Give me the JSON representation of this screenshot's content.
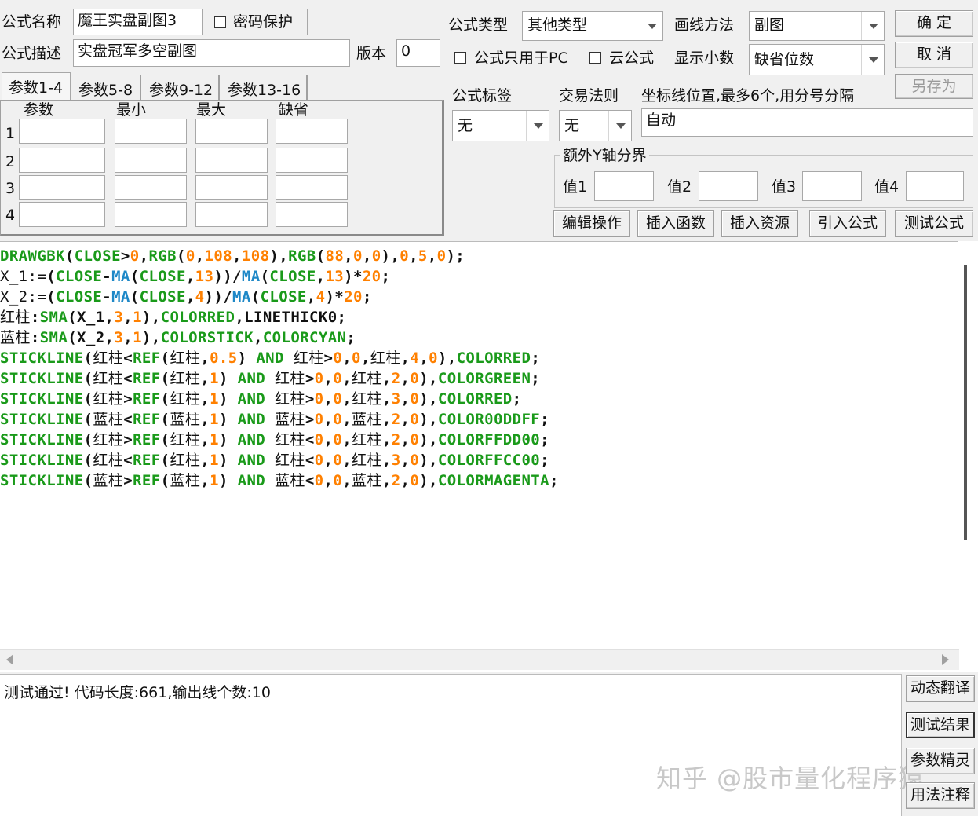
{
  "formula": {
    "name_label": "公式名称",
    "name_value": "魔王实盘副图3",
    "password_label": "密码保护",
    "desc_label": "公式描述",
    "desc_value": "实盘冠军多空副图",
    "version_label": "版本",
    "version_value": "0",
    "type_label": "公式类型",
    "type_value": "其他类型",
    "draw_label": "画线方法",
    "draw_value": "副图",
    "pc_only_label": "公式只用于PC",
    "cloud_label": "云公式",
    "decimals_label": "显示小数",
    "decimals_value": "缺省位数",
    "tag_label": "公式标签",
    "tag_value": "无",
    "trade_label": "交易法则",
    "trade_value": "无",
    "coord_label": "坐标线位置,最多6个,用分号分隔",
    "coord_value": "自动",
    "extra_y_label": "额外Y轴分界",
    "extra_y": [
      "值1",
      "值2",
      "值3",
      "值4"
    ]
  },
  "buttons": {
    "ok": "确  定",
    "cancel": "取  消",
    "save_as": "另存为",
    "edit_ops": "编辑操作",
    "insert_func": "插入函数",
    "insert_res": "插入资源",
    "import_formula": "引入公式",
    "test_formula": "测试公式",
    "dyn_translate": "动态翻译",
    "test_result": "测试结果",
    "param_wizard": "参数精灵",
    "usage_notes": "用法注释"
  },
  "tabs": [
    "参数1-4",
    "参数5-8",
    "参数9-12",
    "参数13-16"
  ],
  "params": {
    "headers": [
      "参数",
      "最小",
      "最大",
      "缺省"
    ],
    "rows": [
      "1",
      "2",
      "3",
      "4"
    ]
  },
  "code_lines": [
    [
      [
        "fn",
        "DRAWGBK"
      ],
      [
        "op",
        "("
      ],
      [
        "fn",
        "CLOSE"
      ],
      [
        "op",
        ">"
      ],
      [
        "num",
        "0"
      ],
      [
        "op",
        ","
      ],
      [
        "fn",
        "RGB"
      ],
      [
        "op",
        "("
      ],
      [
        "num",
        "0"
      ],
      [
        "op",
        ","
      ],
      [
        "num",
        "108"
      ],
      [
        "op",
        ","
      ],
      [
        "num",
        "108"
      ],
      [
        "op",
        "),"
      ],
      [
        "fn",
        "RGB"
      ],
      [
        "op",
        "("
      ],
      [
        "num",
        "88"
      ],
      [
        "op",
        ","
      ],
      [
        "num",
        "0"
      ],
      [
        "op",
        ","
      ],
      [
        "num",
        "0"
      ],
      [
        "op",
        "),"
      ],
      [
        "num",
        "0"
      ],
      [
        "op",
        ","
      ],
      [
        "num",
        "5"
      ],
      [
        "op",
        ","
      ],
      [
        "num",
        "0"
      ],
      [
        "op",
        ");"
      ]
    ],
    [
      [
        "var",
        "X_1:="
      ],
      [
        "op",
        "("
      ],
      [
        "fn",
        "CLOSE"
      ],
      [
        "op",
        "-"
      ],
      [
        "blue",
        "MA"
      ],
      [
        "op",
        "("
      ],
      [
        "fn",
        "CLOSE"
      ],
      [
        "op",
        ","
      ],
      [
        "num",
        "13"
      ],
      [
        "op",
        "))/"
      ],
      [
        "blue",
        "MA"
      ],
      [
        "op",
        "("
      ],
      [
        "fn",
        "CLOSE"
      ],
      [
        "op",
        ","
      ],
      [
        "num",
        "13"
      ],
      [
        "op",
        ")*"
      ],
      [
        "num",
        "20"
      ],
      [
        "op",
        ";"
      ]
    ],
    [
      [
        "var",
        "X_2:="
      ],
      [
        "op",
        "("
      ],
      [
        "fn",
        "CLOSE"
      ],
      [
        "op",
        "-"
      ],
      [
        "blue",
        "MA"
      ],
      [
        "op",
        "("
      ],
      [
        "fn",
        "CLOSE"
      ],
      [
        "op",
        ","
      ],
      [
        "num",
        "4"
      ],
      [
        "op",
        "))/"
      ],
      [
        "blue",
        "MA"
      ],
      [
        "op",
        "("
      ],
      [
        "fn",
        "CLOSE"
      ],
      [
        "op",
        ","
      ],
      [
        "num",
        "4"
      ],
      [
        "op",
        ")*"
      ],
      [
        "num",
        "20"
      ],
      [
        "op",
        ";"
      ]
    ],
    [
      [
        "var",
        "红柱"
      ],
      [
        "op",
        ":"
      ],
      [
        "fn",
        "SMA"
      ],
      [
        "op",
        "(X_1,"
      ],
      [
        "num",
        "3"
      ],
      [
        "op",
        ","
      ],
      [
        "num",
        "1"
      ],
      [
        "op",
        "),"
      ],
      [
        "fn",
        "COLORRED"
      ],
      [
        "op",
        ",LINETHICK0;"
      ]
    ],
    [
      [
        "var",
        "蓝柱"
      ],
      [
        "op",
        ":"
      ],
      [
        "fn",
        "SMA"
      ],
      [
        "op",
        "(X_2,"
      ],
      [
        "num",
        "3"
      ],
      [
        "op",
        ","
      ],
      [
        "num",
        "1"
      ],
      [
        "op",
        "),"
      ],
      [
        "fn",
        "COLORSTICK"
      ],
      [
        "op",
        ","
      ],
      [
        "fn",
        "COLORCYAN"
      ],
      [
        "op",
        ";"
      ]
    ],
    [
      [
        "fn",
        "STICKLINE"
      ],
      [
        "op",
        "("
      ],
      [
        "var",
        "红柱"
      ],
      [
        "op",
        "<"
      ],
      [
        "fn",
        "REF"
      ],
      [
        "op",
        "("
      ],
      [
        "var",
        "红柱"
      ],
      [
        "op",
        ","
      ],
      [
        "num",
        "0.5"
      ],
      [
        "op",
        ") "
      ],
      [
        "fn",
        "AND"
      ],
      [
        "op",
        " "
      ],
      [
        "var",
        "红柱"
      ],
      [
        "op",
        ">"
      ],
      [
        "num",
        "0"
      ],
      [
        "op",
        ","
      ],
      [
        "num",
        "0"
      ],
      [
        "op",
        ","
      ],
      [
        "var",
        "红柱"
      ],
      [
        "op",
        ","
      ],
      [
        "num",
        "4"
      ],
      [
        "op",
        ","
      ],
      [
        "num",
        "0"
      ],
      [
        "op",
        "),"
      ],
      [
        "fn",
        "COLORRED"
      ],
      [
        "op",
        ";"
      ]
    ],
    [
      [
        "fn",
        "STICKLINE"
      ],
      [
        "op",
        "("
      ],
      [
        "var",
        "红柱"
      ],
      [
        "op",
        "<"
      ],
      [
        "fn",
        "REF"
      ],
      [
        "op",
        "("
      ],
      [
        "var",
        "红柱"
      ],
      [
        "op",
        ","
      ],
      [
        "num",
        "1"
      ],
      [
        "op",
        ") "
      ],
      [
        "fn",
        "AND"
      ],
      [
        "op",
        " "
      ],
      [
        "var",
        "红柱"
      ],
      [
        "op",
        ">"
      ],
      [
        "num",
        "0"
      ],
      [
        "op",
        ","
      ],
      [
        "num",
        "0"
      ],
      [
        "op",
        ","
      ],
      [
        "var",
        "红柱"
      ],
      [
        "op",
        ","
      ],
      [
        "num",
        "2"
      ],
      [
        "op",
        ","
      ],
      [
        "num",
        "0"
      ],
      [
        "op",
        "),"
      ],
      [
        "fn",
        "COLORGREEN"
      ],
      [
        "op",
        ";"
      ]
    ],
    [
      [
        "fn",
        "STICKLINE"
      ],
      [
        "op",
        "("
      ],
      [
        "var",
        "红柱"
      ],
      [
        "op",
        ">"
      ],
      [
        "fn",
        "REF"
      ],
      [
        "op",
        "("
      ],
      [
        "var",
        "红柱"
      ],
      [
        "op",
        ","
      ],
      [
        "num",
        "1"
      ],
      [
        "op",
        ") "
      ],
      [
        "fn",
        "AND"
      ],
      [
        "op",
        " "
      ],
      [
        "var",
        "红柱"
      ],
      [
        "op",
        ">"
      ],
      [
        "num",
        "0"
      ],
      [
        "op",
        ","
      ],
      [
        "num",
        "0"
      ],
      [
        "op",
        ","
      ],
      [
        "var",
        "红柱"
      ],
      [
        "op",
        ","
      ],
      [
        "num",
        "3"
      ],
      [
        "op",
        ","
      ],
      [
        "num",
        "0"
      ],
      [
        "op",
        "),"
      ],
      [
        "fn",
        "COLORRED"
      ],
      [
        "op",
        ";"
      ]
    ],
    [
      [
        "fn",
        "STICKLINE"
      ],
      [
        "op",
        "("
      ],
      [
        "var",
        "蓝柱"
      ],
      [
        "op",
        "<"
      ],
      [
        "fn",
        "REF"
      ],
      [
        "op",
        "("
      ],
      [
        "var",
        "蓝柱"
      ],
      [
        "op",
        ","
      ],
      [
        "num",
        "1"
      ],
      [
        "op",
        ") "
      ],
      [
        "fn",
        "AND"
      ],
      [
        "op",
        " "
      ],
      [
        "var",
        "蓝柱"
      ],
      [
        "op",
        ">"
      ],
      [
        "num",
        "0"
      ],
      [
        "op",
        ","
      ],
      [
        "num",
        "0"
      ],
      [
        "op",
        ","
      ],
      [
        "var",
        "蓝柱"
      ],
      [
        "op",
        ","
      ],
      [
        "num",
        "2"
      ],
      [
        "op",
        ","
      ],
      [
        "num",
        "0"
      ],
      [
        "op",
        "),"
      ],
      [
        "fn",
        "COLOR00DDFF"
      ],
      [
        "op",
        ";"
      ]
    ],
    [
      [
        "fn",
        "STICKLINE"
      ],
      [
        "op",
        "("
      ],
      [
        "var",
        "红柱"
      ],
      [
        "op",
        ">"
      ],
      [
        "fn",
        "REF"
      ],
      [
        "op",
        "("
      ],
      [
        "var",
        "红柱"
      ],
      [
        "op",
        ","
      ],
      [
        "num",
        "1"
      ],
      [
        "op",
        ") "
      ],
      [
        "fn",
        "AND"
      ],
      [
        "op",
        " "
      ],
      [
        "var",
        "红柱"
      ],
      [
        "op",
        "<"
      ],
      [
        "num",
        "0"
      ],
      [
        "op",
        ","
      ],
      [
        "num",
        "0"
      ],
      [
        "op",
        ","
      ],
      [
        "var",
        "红柱"
      ],
      [
        "op",
        ","
      ],
      [
        "num",
        "2"
      ],
      [
        "op",
        ","
      ],
      [
        "num",
        "0"
      ],
      [
        "op",
        "),"
      ],
      [
        "fn",
        "COLORFFDD00"
      ],
      [
        "op",
        ";"
      ]
    ],
    [
      [
        "fn",
        "STICKLINE"
      ],
      [
        "op",
        "("
      ],
      [
        "var",
        "红柱"
      ],
      [
        "op",
        "<"
      ],
      [
        "fn",
        "REF"
      ],
      [
        "op",
        "("
      ],
      [
        "var",
        "红柱"
      ],
      [
        "op",
        ","
      ],
      [
        "num",
        "1"
      ],
      [
        "op",
        ") "
      ],
      [
        "fn",
        "AND"
      ],
      [
        "op",
        " "
      ],
      [
        "var",
        "红柱"
      ],
      [
        "op",
        "<"
      ],
      [
        "num",
        "0"
      ],
      [
        "op",
        ","
      ],
      [
        "num",
        "0"
      ],
      [
        "op",
        ","
      ],
      [
        "var",
        "红柱"
      ],
      [
        "op",
        ","
      ],
      [
        "num",
        "3"
      ],
      [
        "op",
        ","
      ],
      [
        "num",
        "0"
      ],
      [
        "op",
        "),"
      ],
      [
        "fn",
        "COLORFFCC00"
      ],
      [
        "op",
        ";"
      ]
    ],
    [
      [
        "fn",
        "STICKLINE"
      ],
      [
        "op",
        "("
      ],
      [
        "var",
        "蓝柱"
      ],
      [
        "op",
        ">"
      ],
      [
        "fn",
        "REF"
      ],
      [
        "op",
        "("
      ],
      [
        "var",
        "蓝柱"
      ],
      [
        "op",
        ","
      ],
      [
        "num",
        "1"
      ],
      [
        "op",
        ") "
      ],
      [
        "fn",
        "AND"
      ],
      [
        "op",
        " "
      ],
      [
        "var",
        "蓝柱"
      ],
      [
        "op",
        "<"
      ],
      [
        "num",
        "0"
      ],
      [
        "op",
        ","
      ],
      [
        "num",
        "0"
      ],
      [
        "op",
        ","
      ],
      [
        "var",
        "蓝柱"
      ],
      [
        "op",
        ","
      ],
      [
        "num",
        "2"
      ],
      [
        "op",
        ","
      ],
      [
        "num",
        "0"
      ],
      [
        "op",
        "),"
      ],
      [
        "fn",
        "COLORMAGENTA"
      ],
      [
        "op",
        ";"
      ]
    ]
  ],
  "result_text": "测试通过! 代码长度:661,输出线个数:10",
  "watermark": "知乎 @股市量化程序猿",
  "colors": {
    "function": "#1a9a1a",
    "number": "#ff8000",
    "ma_function": "#1e88c7",
    "background": "#f0f0f0"
  }
}
